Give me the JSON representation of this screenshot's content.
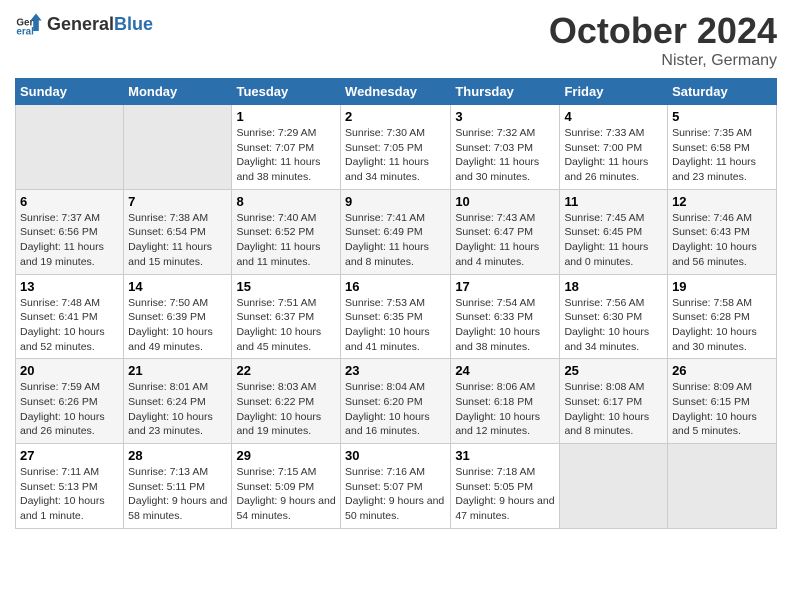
{
  "header": {
    "logo": {
      "general": "General",
      "blue": "Blue"
    },
    "title": "October 2024",
    "location": "Nister, Germany"
  },
  "weekdays": [
    "Sunday",
    "Monday",
    "Tuesday",
    "Wednesday",
    "Thursday",
    "Friday",
    "Saturday"
  ],
  "weeks": [
    [
      {
        "day": "",
        "empty": true
      },
      {
        "day": "",
        "empty": true
      },
      {
        "day": "1",
        "sunrise": "7:29 AM",
        "sunset": "7:07 PM",
        "daylight": "11 hours and 38 minutes."
      },
      {
        "day": "2",
        "sunrise": "7:30 AM",
        "sunset": "7:05 PM",
        "daylight": "11 hours and 34 minutes."
      },
      {
        "day": "3",
        "sunrise": "7:32 AM",
        "sunset": "7:03 PM",
        "daylight": "11 hours and 30 minutes."
      },
      {
        "day": "4",
        "sunrise": "7:33 AM",
        "sunset": "7:00 PM",
        "daylight": "11 hours and 26 minutes."
      },
      {
        "day": "5",
        "sunrise": "7:35 AM",
        "sunset": "6:58 PM",
        "daylight": "11 hours and 23 minutes."
      }
    ],
    [
      {
        "day": "6",
        "sunrise": "7:37 AM",
        "sunset": "6:56 PM",
        "daylight": "11 hours and 19 minutes."
      },
      {
        "day": "7",
        "sunrise": "7:38 AM",
        "sunset": "6:54 PM",
        "daylight": "11 hours and 15 minutes."
      },
      {
        "day": "8",
        "sunrise": "7:40 AM",
        "sunset": "6:52 PM",
        "daylight": "11 hours and 11 minutes."
      },
      {
        "day": "9",
        "sunrise": "7:41 AM",
        "sunset": "6:49 PM",
        "daylight": "11 hours and 8 minutes."
      },
      {
        "day": "10",
        "sunrise": "7:43 AM",
        "sunset": "6:47 PM",
        "daylight": "11 hours and 4 minutes."
      },
      {
        "day": "11",
        "sunrise": "7:45 AM",
        "sunset": "6:45 PM",
        "daylight": "11 hours and 0 minutes."
      },
      {
        "day": "12",
        "sunrise": "7:46 AM",
        "sunset": "6:43 PM",
        "daylight": "10 hours and 56 minutes."
      }
    ],
    [
      {
        "day": "13",
        "sunrise": "7:48 AM",
        "sunset": "6:41 PM",
        "daylight": "10 hours and 52 minutes."
      },
      {
        "day": "14",
        "sunrise": "7:50 AM",
        "sunset": "6:39 PM",
        "daylight": "10 hours and 49 minutes."
      },
      {
        "day": "15",
        "sunrise": "7:51 AM",
        "sunset": "6:37 PM",
        "daylight": "10 hours and 45 minutes."
      },
      {
        "day": "16",
        "sunrise": "7:53 AM",
        "sunset": "6:35 PM",
        "daylight": "10 hours and 41 minutes."
      },
      {
        "day": "17",
        "sunrise": "7:54 AM",
        "sunset": "6:33 PM",
        "daylight": "10 hours and 38 minutes."
      },
      {
        "day": "18",
        "sunrise": "7:56 AM",
        "sunset": "6:30 PM",
        "daylight": "10 hours and 34 minutes."
      },
      {
        "day": "19",
        "sunrise": "7:58 AM",
        "sunset": "6:28 PM",
        "daylight": "10 hours and 30 minutes."
      }
    ],
    [
      {
        "day": "20",
        "sunrise": "7:59 AM",
        "sunset": "6:26 PM",
        "daylight": "10 hours and 26 minutes."
      },
      {
        "day": "21",
        "sunrise": "8:01 AM",
        "sunset": "6:24 PM",
        "daylight": "10 hours and 23 minutes."
      },
      {
        "day": "22",
        "sunrise": "8:03 AM",
        "sunset": "6:22 PM",
        "daylight": "10 hours and 19 minutes."
      },
      {
        "day": "23",
        "sunrise": "8:04 AM",
        "sunset": "6:20 PM",
        "daylight": "10 hours and 16 minutes."
      },
      {
        "day": "24",
        "sunrise": "8:06 AM",
        "sunset": "6:18 PM",
        "daylight": "10 hours and 12 minutes."
      },
      {
        "day": "25",
        "sunrise": "8:08 AM",
        "sunset": "6:17 PM",
        "daylight": "10 hours and 8 minutes."
      },
      {
        "day": "26",
        "sunrise": "8:09 AM",
        "sunset": "6:15 PM",
        "daylight": "10 hours and 5 minutes."
      }
    ],
    [
      {
        "day": "27",
        "sunrise": "7:11 AM",
        "sunset": "5:13 PM",
        "daylight": "10 hours and 1 minute."
      },
      {
        "day": "28",
        "sunrise": "7:13 AM",
        "sunset": "5:11 PM",
        "daylight": "9 hours and 58 minutes."
      },
      {
        "day": "29",
        "sunrise": "7:15 AM",
        "sunset": "5:09 PM",
        "daylight": "9 hours and 54 minutes."
      },
      {
        "day": "30",
        "sunrise": "7:16 AM",
        "sunset": "5:07 PM",
        "daylight": "9 hours and 50 minutes."
      },
      {
        "day": "31",
        "sunrise": "7:18 AM",
        "sunset": "5:05 PM",
        "daylight": "9 hours and 47 minutes."
      },
      {
        "day": "",
        "empty": true
      },
      {
        "day": "",
        "empty": true
      }
    ]
  ],
  "daylight_label": "Daylight:"
}
